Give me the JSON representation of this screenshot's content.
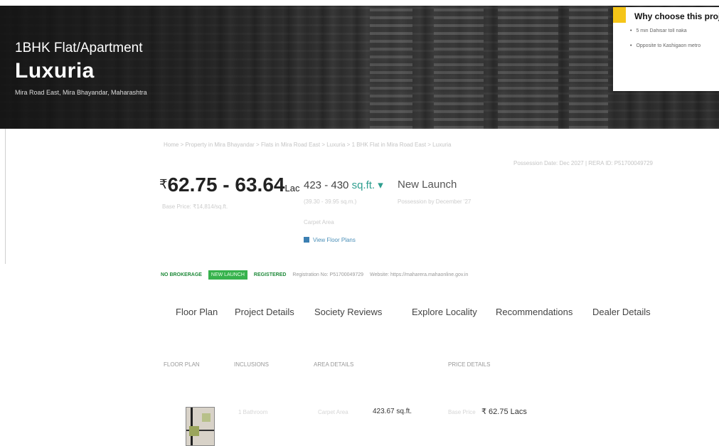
{
  "hero": {
    "property_type": "1BHK Flat/Apartment",
    "property_name": "Luxuria",
    "location": "Mira Road East, Mira Bhayandar, Maharashtra"
  },
  "why_choose": {
    "title": "Why choose this project",
    "points": [
      "5 min Dahisar toll naka",
      "Opposite to Kashigaon metro"
    ]
  },
  "breadcrumb": "Home > Property in Mira Bhayandar > Flats in Mira Road East > Luxuria > 1 BHK Flat in Mira Road East > Luxuria",
  "rera_right": "Possession Date: Dec 2027 | RERA ID: P51700049729",
  "price": {
    "currency_symbol": "₹",
    "range": "62.75 - 63.64",
    "unit": "Lac",
    "sub": "Base Price: ₹14,814/sq.ft."
  },
  "area": {
    "range": "423 - 430",
    "unit": "sq.ft.",
    "dropdown": "▾",
    "sub1": "(39.30 - 39.95 sq.m.)",
    "sub2": "Carpet Area",
    "view_floor_plans": "View Floor Plans"
  },
  "status": {
    "label": "New Launch",
    "sub": "Possession by December '27"
  },
  "badges": {
    "no_brokerage": "NO BROKERAGE",
    "new_launch": "NEW LAUNCH",
    "registered": "REGISTERED",
    "registration_no": "Registration No: P51700049729",
    "website": "Website: https://maharera.mahaonline.gov.in"
  },
  "tabs": [
    "Floor Plan",
    "Project Details",
    "Society Reviews",
    "Explore Locality",
    "Recommendations",
    "Dealer Details"
  ],
  "table": {
    "headers": [
      "FLOOR PLAN",
      "INCLUSIONS",
      "AREA DETAILS",
      "PRICE DETAILS"
    ],
    "row": {
      "inclusion": "1 Bathroom",
      "area_label": "Carpet Area",
      "area_value": "423.67 sq.ft.",
      "price_label": "Base Price",
      "price_value": "₹ 62.75 Lacs"
    }
  }
}
